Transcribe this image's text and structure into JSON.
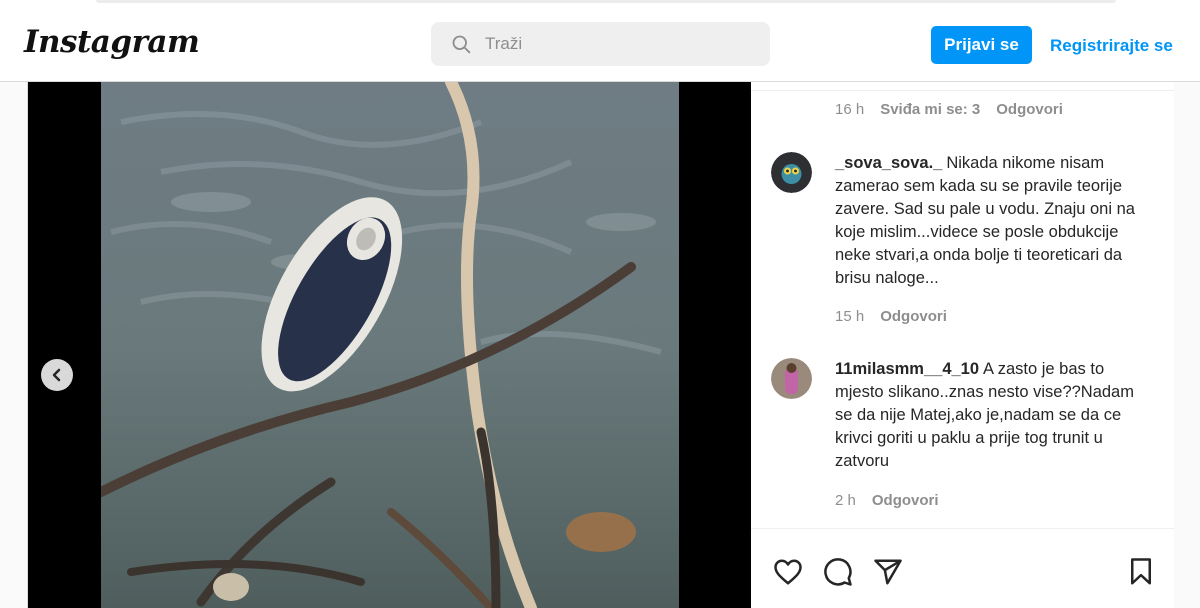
{
  "header": {
    "logo": "Instagram",
    "search_placeholder": "Traži",
    "login_label": "Prijavi se",
    "signup_label": "Registrirajte se"
  },
  "comments": {
    "first_meta": {
      "time": "16 h",
      "likes": "Sviđa mi se: 3",
      "reply": "Odgovori"
    },
    "items": [
      {
        "username": "_sova_sova._",
        "text": "Nikada nikome nisam zamerao sem kada su se pravile teorije zavere. Sad su pale u vodu. Znaju oni na koje mislim...videce se posle obdukcije neke stvari,a onda bolje ti teoreticari da brisu naloge...",
        "time": "15 h",
        "reply": "Odgovori"
      },
      {
        "username": "11milasmm__4_10",
        "text": "A zasto je bas to mjesto slikano..znas nesto vise??Nadam se da nije Matej,ako je,nadam se da ce krivci goriti u paklu a prije tog trunit u zatvoru",
        "time": "2 h",
        "reply": "Odgovori"
      }
    ]
  },
  "actions": [
    "heart-icon",
    "comment-icon",
    "share-icon",
    "bookmark-icon"
  ],
  "colors": {
    "accent": "#0095f6",
    "muted": "#8e8e8e",
    "text": "#262626"
  }
}
